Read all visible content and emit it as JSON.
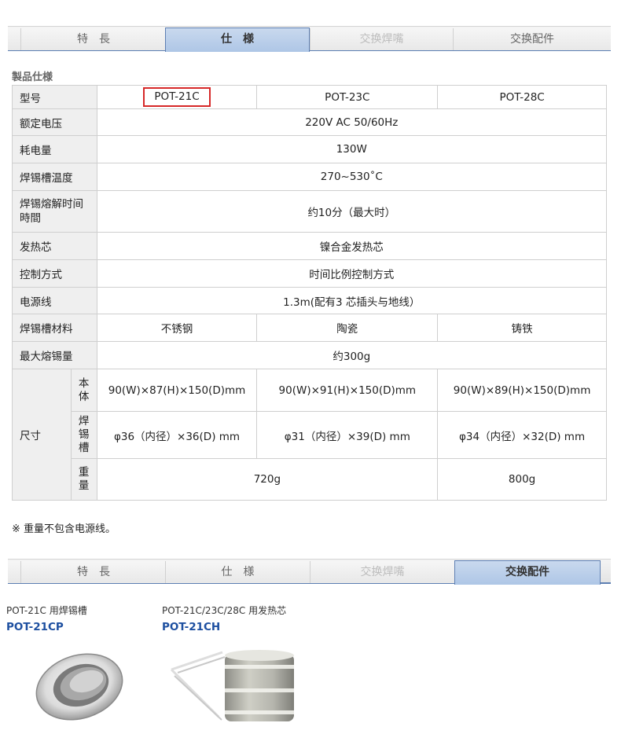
{
  "tabs_top": [
    {
      "label": "特　長",
      "state": "normal"
    },
    {
      "label": "仕　様",
      "state": "active"
    },
    {
      "label": "交换焊嘴",
      "state": "disabled"
    },
    {
      "label": "交换配件",
      "state": "normal"
    }
  ],
  "spec_section": {
    "title": "製品仕様",
    "rows": {
      "model": {
        "label": "型号",
        "values": [
          "POT-21C",
          "POT-23C",
          "POT-28C"
        ]
      },
      "voltage": {
        "label": "额定电压",
        "value": "220V AC 50/60Hz"
      },
      "power": {
        "label": "耗电量",
        "value": "130W"
      },
      "temp": {
        "label": "焊锡槽温度",
        "value": "270~530˚C"
      },
      "melt": {
        "label_line1": "焊锡熔解时间",
        "label_line2": "時間",
        "value": "约10分（最大时）"
      },
      "heater": {
        "label": "发热芯",
        "value": "镍合金发热芯"
      },
      "control": {
        "label": "控制方式",
        "value": "时间比例控制方式"
      },
      "cord": {
        "label": "电源线",
        "value": "1.3m(配有3 芯插头与地线）"
      },
      "material": {
        "label": "焊锡槽材料",
        "values": [
          "不锈钢",
          "陶瓷",
          "铸铁"
        ]
      },
      "capacity": {
        "label": "最大熔锡量",
        "value": "约300g"
      },
      "size": {
        "label": "尺寸",
        "body": {
          "label": [
            "本",
            "体"
          ],
          "values": [
            "90(W)×87(H)×150(D)mm",
            "90(W)×91(H)×150(D)mm",
            "90(W)×89(H)×150(D)mm"
          ]
        },
        "pot": {
          "label": [
            "焊",
            "锡",
            "槽"
          ],
          "values": [
            "φ36（内径）×36(D) mm",
            "φ31（内径）×39(D) mm",
            "φ34（内径）×32(D) mm"
          ]
        },
        "weight": {
          "label": [
            "重",
            "量"
          ],
          "values": [
            "720g",
            "800g"
          ]
        }
      }
    },
    "note": "※ 重量不包含电源线。"
  },
  "tabs_bottom": [
    {
      "label": "特　長",
      "state": "normal"
    },
    {
      "label": "仕　様",
      "state": "normal"
    },
    {
      "label": "交换焊嘴",
      "state": "disabled"
    },
    {
      "label": "交换配件",
      "state": "active"
    }
  ],
  "accessories": [
    {
      "caption": "POT-21C 用焊锡槽",
      "code": "POT-21CP",
      "image": "solder-pot-ring-image"
    },
    {
      "caption": "POT-21C/23C/28C 用发热芯",
      "code": "POT-21CH",
      "image": "heater-core-image"
    }
  ],
  "colors": {
    "accent_blue": "#1d4fa0",
    "tab_active": "#aec6e6",
    "highlight_red": "#d62828"
  }
}
